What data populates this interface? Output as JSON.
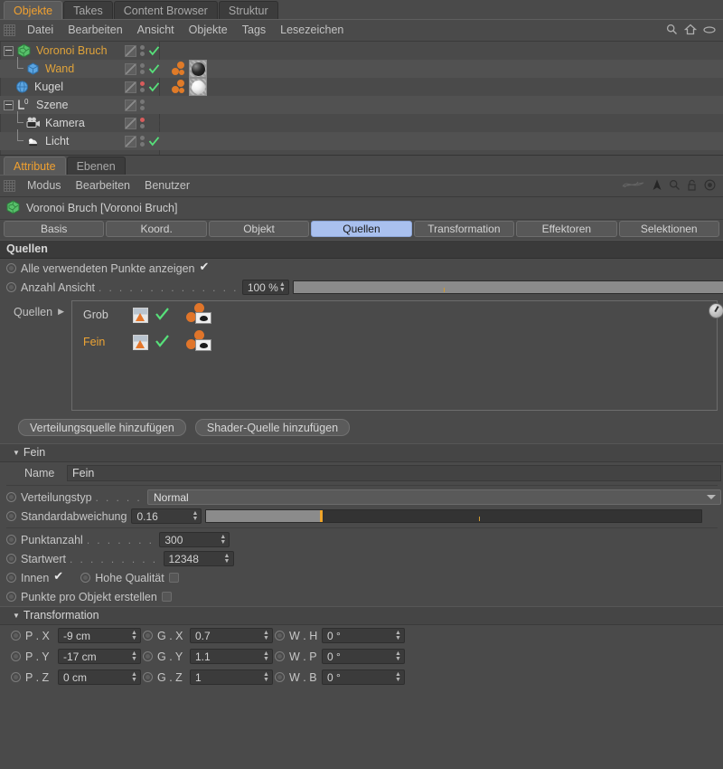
{
  "object_manager": {
    "tabs": [
      {
        "label": "Objekte",
        "active": true
      },
      {
        "label": "Takes",
        "active": false
      },
      {
        "label": "Content Browser",
        "active": false
      },
      {
        "label": "Struktur",
        "active": false
      }
    ],
    "menu": [
      "Datei",
      "Bearbeiten",
      "Ansicht",
      "Objekte",
      "Tags",
      "Lesezeichen"
    ],
    "header_icons": [
      "search-icon",
      "home-icon",
      "eye-icon"
    ],
    "rows": [
      {
        "label": "Voronoi Bruch",
        "color": "orange",
        "depth": 0,
        "expander": true,
        "icon": "voronoi-fracture-icon",
        "dot": "gray",
        "tick": true,
        "materials": [
          "dark"
        ]
      },
      {
        "label": "Wand",
        "color": "orange",
        "depth": 1,
        "expander": false,
        "icon": "cube-icon",
        "dot": "gray",
        "tick": true,
        "materials": [
          "dark"
        ]
      },
      {
        "label": "Kugel",
        "color": "white",
        "depth": 0,
        "expander": false,
        "icon": "sphere-icon",
        "dot": "red",
        "tick": true,
        "materials": [
          "light"
        ]
      },
      {
        "label": "Szene",
        "color": "white",
        "depth": 0,
        "expander": true,
        "icon": "null-object-icon",
        "dot": "gray",
        "tick": false,
        "materials": []
      },
      {
        "label": "Kamera",
        "color": "white",
        "depth": 1,
        "expander": false,
        "icon": "camera-icon",
        "dot": "red",
        "tick": false,
        "materials": []
      },
      {
        "label": "Licht",
        "color": "white",
        "depth": 1,
        "expander": false,
        "icon": "light-icon",
        "dot": "gray",
        "tick": true,
        "materials": []
      }
    ]
  },
  "attribute_manager": {
    "tabs": [
      {
        "label": "Attribute",
        "active": true
      },
      {
        "label": "Ebenen",
        "active": false
      }
    ],
    "menu": [
      "Modus",
      "Bearbeiten",
      "Benutzer"
    ],
    "toolbar_icons": [
      "curve-icon",
      "pin-icon",
      "search-icon",
      "lock-icon",
      "target-icon"
    ],
    "object_title": "Voronoi Bruch [Voronoi Bruch]",
    "object_icon": "voronoi-fracture-icon",
    "attr_tabs": [
      {
        "label": "Basis",
        "active": false
      },
      {
        "label": "Koord.",
        "active": false
      },
      {
        "label": "Objekt",
        "active": false
      },
      {
        "label": "Quellen",
        "active": true
      },
      {
        "label": "Transformation",
        "active": false
      },
      {
        "label": "Effektoren",
        "active": false
      },
      {
        "label": "Selektionen",
        "active": false
      }
    ]
  },
  "quellen_section": {
    "title": "Quellen",
    "show_all_points": {
      "label": "Alle verwendeten Punkte anzeigen",
      "checked": true
    },
    "count_view": {
      "label": "Anzahl Ansicht",
      "value": "100 %",
      "slider_fill_pct": 100,
      "tick_pct": 35
    },
    "list_label": "Quellen",
    "sources": [
      {
        "name": "Grob",
        "selected": false,
        "enabled": true
      },
      {
        "name": "Fein",
        "selected": true,
        "enabled": true
      }
    ],
    "buttons": [
      {
        "label": "Verteilungsquelle hinzufügen"
      },
      {
        "label": "Shader-Quelle hinzufügen"
      }
    ]
  },
  "fein_section": {
    "title": "Fein",
    "name_label": "Name",
    "name_value": "Fein",
    "distribution_type": {
      "label": "Verteilungstyp",
      "value": "Normal"
    },
    "standard_deviation": {
      "label": "Standardabweichung",
      "value": "0.16",
      "slider_fill_pct": 23,
      "tick_pct": 55
    },
    "point_count": {
      "label": "Punktanzahl",
      "value": "300"
    },
    "seed": {
      "label": "Startwert",
      "value": "12348"
    },
    "inside": {
      "label": "Innen",
      "checked": true
    },
    "high_quality": {
      "label": "Hohe Qualität",
      "checked": false
    },
    "points_per_object": {
      "label": "Punkte pro Objekt erstellen",
      "checked": false
    }
  },
  "transformation_section": {
    "title": "Transformation",
    "fields": [
      [
        {
          "label": "P . X",
          "value": "-9 cm"
        },
        {
          "label": "G . X",
          "value": "0.7"
        },
        {
          "label": "W . H",
          "value": "0 °"
        }
      ],
      [
        {
          "label": "P . Y",
          "value": "-17 cm"
        },
        {
          "label": "G . Y",
          "value": "1.1"
        },
        {
          "label": "W . P",
          "value": "0 °"
        }
      ],
      [
        {
          "label": "P . Z",
          "value": "0 cm"
        },
        {
          "label": "G . Z",
          "value": "1"
        },
        {
          "label": "W . B",
          "value": "0 °"
        }
      ]
    ]
  },
  "colors": {
    "accent_orange": "#e0a33a",
    "tab_selected_blue": "#a9c0ee",
    "slider_handle": "#f0a52a",
    "check_green": "#57e07a",
    "panel_bg": "#4a4a4a"
  }
}
